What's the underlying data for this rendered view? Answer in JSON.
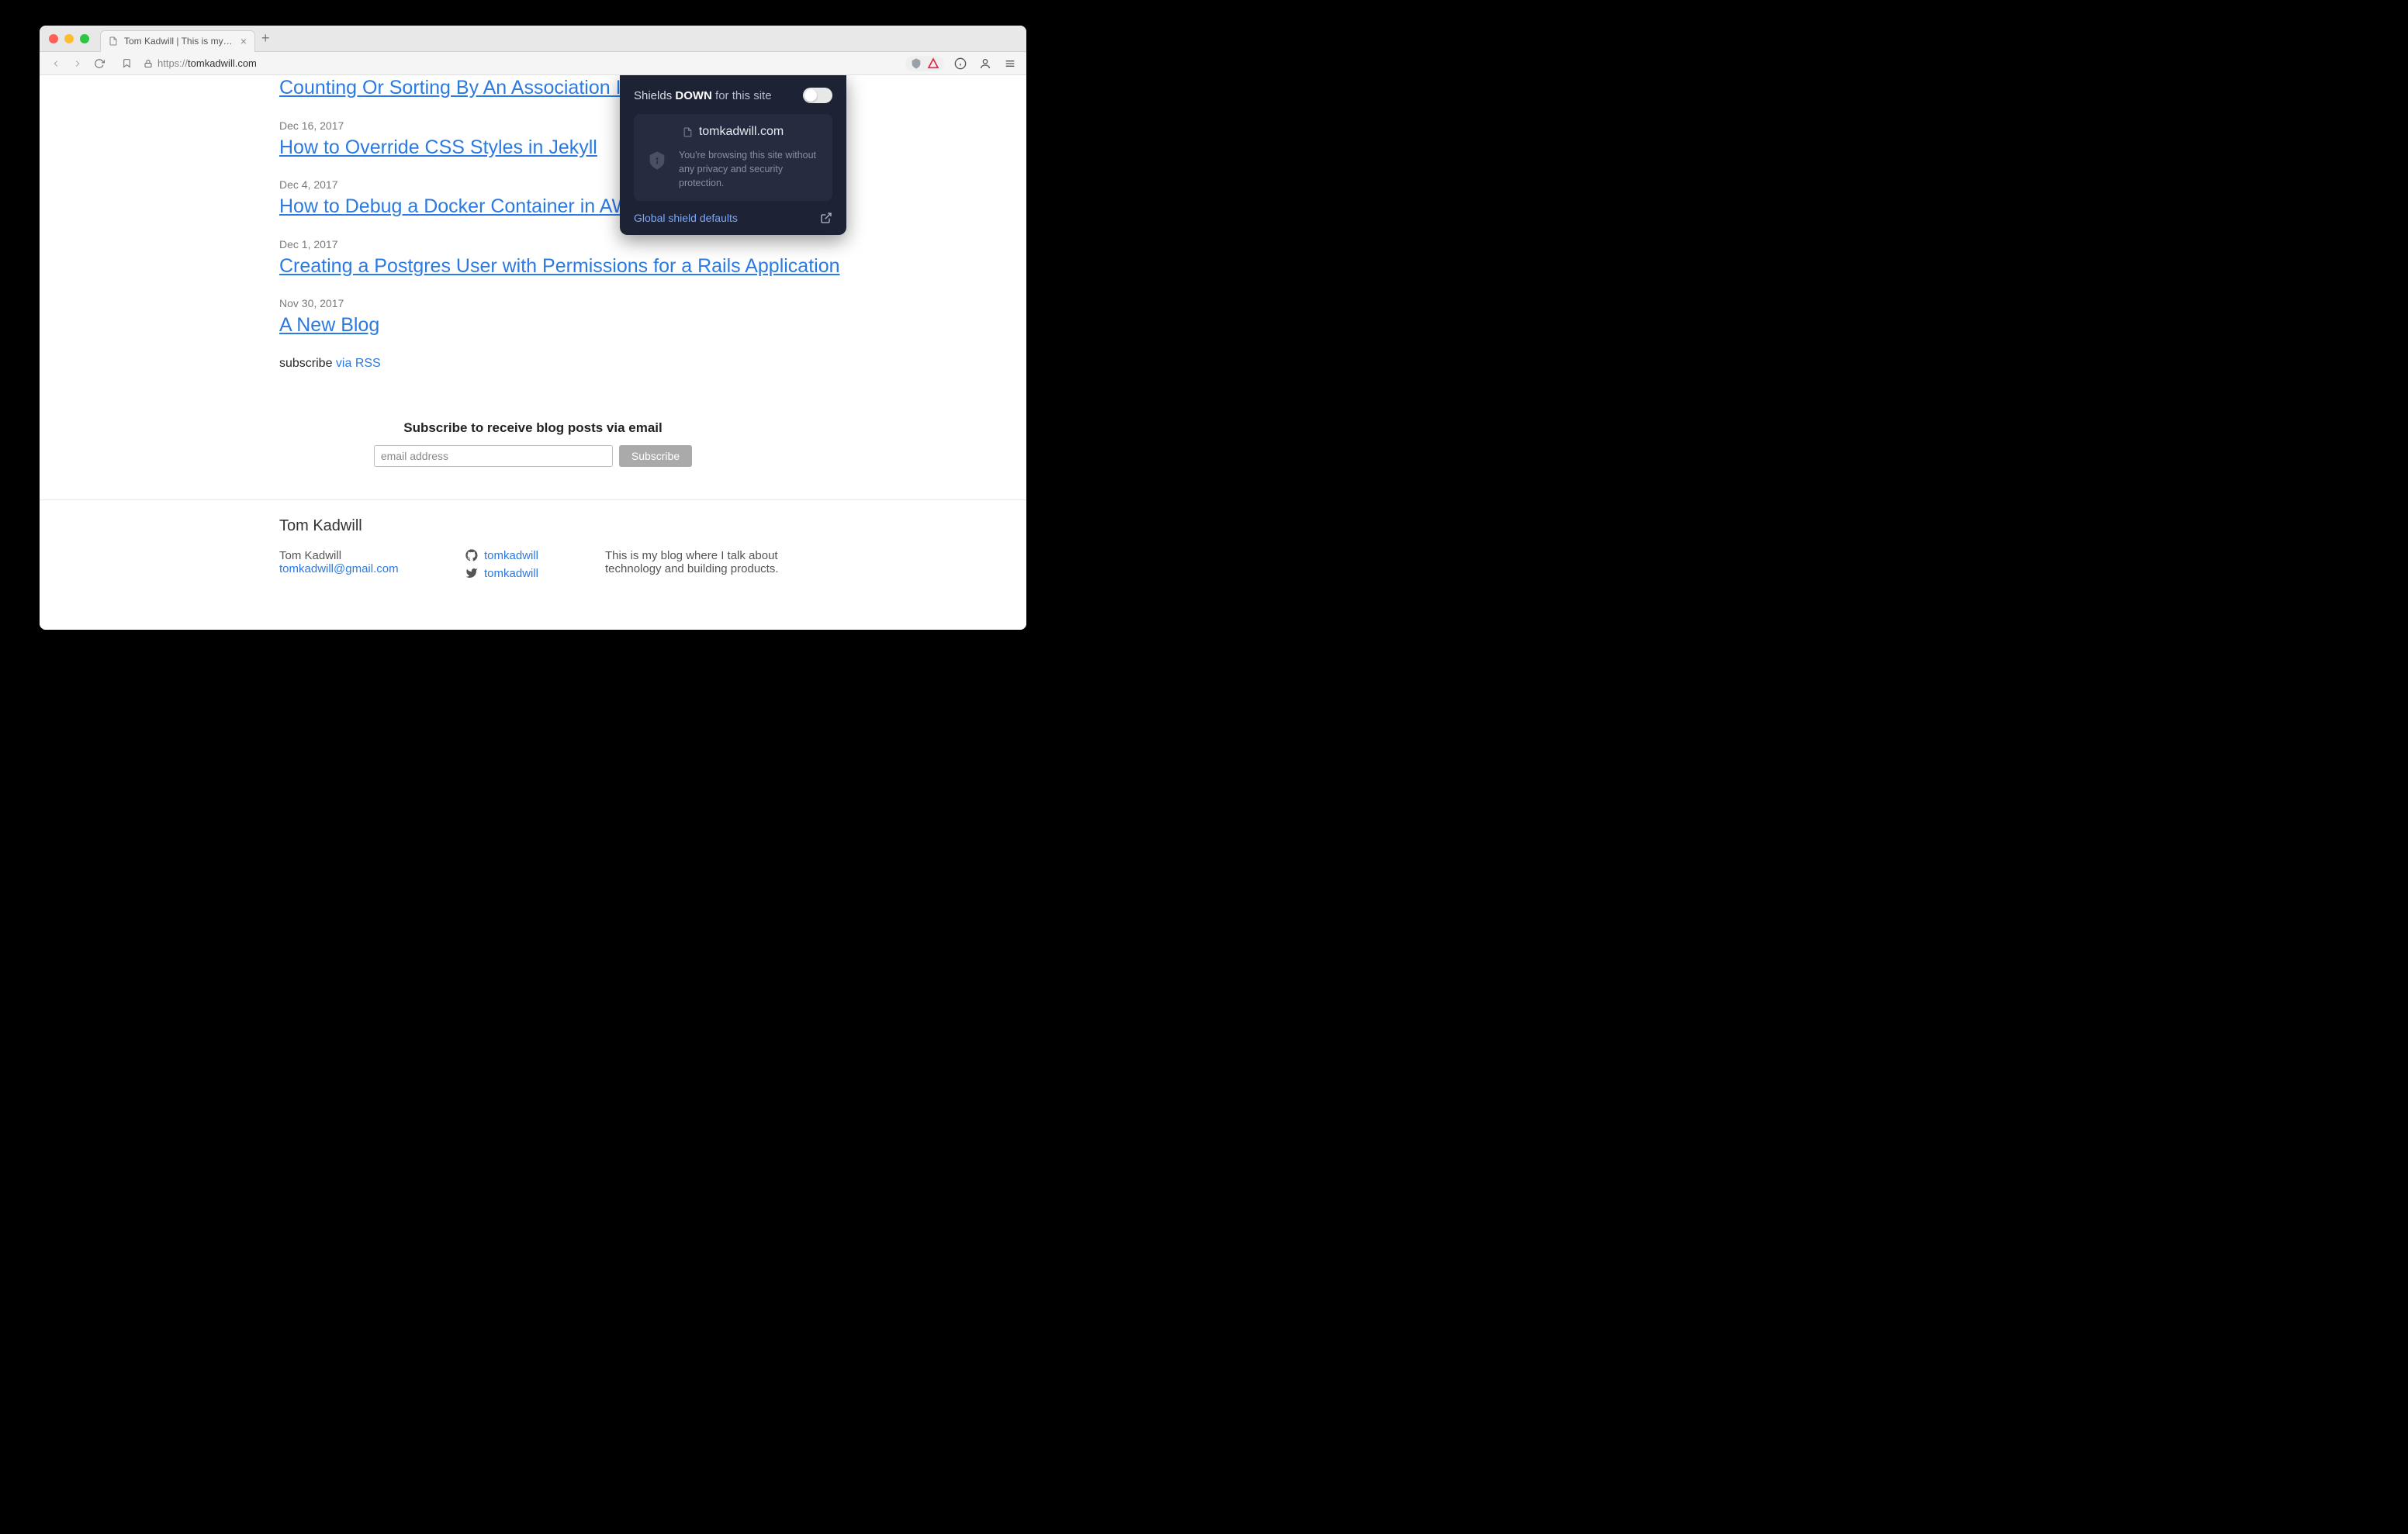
{
  "browser": {
    "tab_title": "Tom Kadwill | This is my blog wh",
    "url_scheme": "https://",
    "url_host": "tomkadwill.com"
  },
  "shields": {
    "prefix": "Shields ",
    "status": "DOWN",
    "suffix": " for this site",
    "site": "tomkadwill.com",
    "message": "You're browsing this site without any privacy and security protection.",
    "global_link": "Global shield defaults"
  },
  "posts": [
    {
      "date": "",
      "title": "Counting Or Sorting By An Association In A Rails"
    },
    {
      "date": "Dec 16, 2017",
      "title": "How to Override CSS Styles in Jekyll"
    },
    {
      "date": "Dec 4, 2017",
      "title": "How to Debug a Docker Container in AWS that w"
    },
    {
      "date": "Dec 1, 2017",
      "title": "Creating a Postgres User with Permissions for a Rails Application"
    },
    {
      "date": "Nov 30, 2017",
      "title": "A New Blog"
    }
  ],
  "subscribe": {
    "label": "subscribe ",
    "link": "via RSS"
  },
  "email": {
    "title": "Subscribe to receive blog posts via email",
    "placeholder": "email address",
    "button": "Subscribe"
  },
  "footer": {
    "heading": "Tom Kadwill",
    "name": "Tom Kadwill",
    "email": "tomkadwill@gmail.com",
    "github": "tomkadwill",
    "twitter": "tomkadwill",
    "about": "This is my blog where I talk about technology and building products."
  }
}
